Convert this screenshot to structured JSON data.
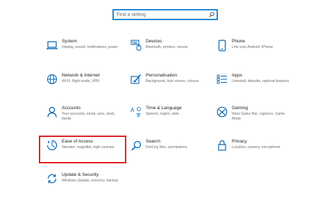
{
  "search": {
    "placeholder": "Find a setting"
  },
  "tiles": [
    {
      "title": "System",
      "desc": "Display, sound, notifications, power",
      "icon": "laptop-icon"
    },
    {
      "title": "Devices",
      "desc": "Bluetooth, printers, mouse",
      "icon": "keyboard-icon"
    },
    {
      "title": "Phone",
      "desc": "Link your Android, iPhone",
      "icon": "phone-icon"
    },
    {
      "title": "Network & Internet",
      "desc": "Wi-Fi, flight mode, VPN",
      "icon": "globe-icon"
    },
    {
      "title": "Personalisation",
      "desc": "Background, lock screen, colours",
      "icon": "paintbrush-icon"
    },
    {
      "title": "Apps",
      "desc": "Uninstall, defaults, optional features",
      "icon": "apps-list-icon"
    },
    {
      "title": "Accounts",
      "desc": "Your accounts, email, sync, work, family",
      "icon": "person-icon"
    },
    {
      "title": "Time & Language",
      "desc": "Speech, region, date",
      "icon": "time-language-icon"
    },
    {
      "title": "Gaming",
      "desc": "Xbox Game Bar, captures, Game Mode",
      "icon": "xbox-icon"
    },
    {
      "title": "Ease of Access",
      "desc": "Narrator, magnifier, high contrast",
      "icon": "ease-of-access-icon"
    },
    {
      "title": "Search",
      "desc": "Find my files, permissions",
      "icon": "search-icon"
    },
    {
      "title": "Privacy",
      "desc": "Location, camera, microphone",
      "icon": "lock-icon"
    },
    {
      "title": "Update & Security",
      "desc": "Windows Update, recovery, backup",
      "icon": "sync-icon"
    }
  ],
  "colors": {
    "accent": "#0063b1",
    "highlight": "#e31e24",
    "search_border": "#1e88d3"
  }
}
